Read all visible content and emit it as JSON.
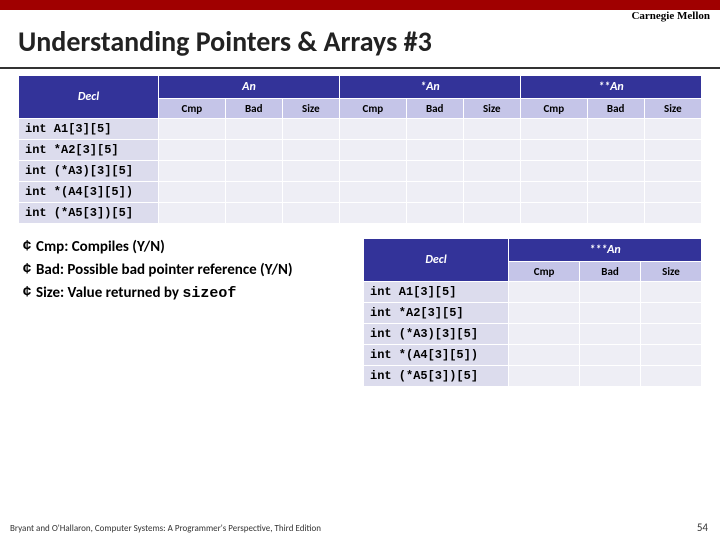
{
  "brand": "Carnegie Mellon",
  "title": "Understanding Pointers & Arrays #3",
  "main_table": {
    "top_headers": [
      "Decl",
      "An",
      "*An",
      "**An"
    ],
    "sub_headers": [
      "Cmp",
      "Bad",
      "Size"
    ],
    "decls": [
      "int A1[3][5]",
      "int *A2[3][5]",
      "int (*A3)[3][5]",
      "int *(A4[3][5])",
      "int (*A5[3])[5]"
    ]
  },
  "bullets": [
    "Cmp: Compiles (Y/N)",
    "Bad: Possible bad pointer reference (Y/N)",
    "Size: Value returned by "
  ],
  "sizeof": "sizeof",
  "small_table": {
    "top_headers": [
      "Decl",
      "***An"
    ],
    "sub_headers": [
      "Cmp",
      "Bad",
      "Size"
    ],
    "decls": [
      "int A1[3][5]",
      "int *A2[3][5]",
      "int (*A3)[3][5]",
      "int *(A4[3][5])",
      "int (*A5[3])[5]"
    ]
  },
  "footer": "Bryant and O'Hallaron, Computer Systems: A Programmer's Perspective, Third Edition",
  "page": "54"
}
